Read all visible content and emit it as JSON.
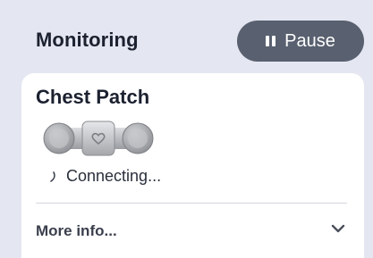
{
  "monitoring": {
    "title": "Monitoring",
    "pause_label": "Pause"
  },
  "device": {
    "name": "Chest Patch",
    "status": "Connecting...",
    "more_info_label": "More info..."
  },
  "colors": {
    "background": "#e4e6f1",
    "pause_button": "#59606f",
    "card": "#ffffff"
  },
  "icons": [
    "pause-icon",
    "chest-patch-device-icon",
    "heart-icon",
    "connecting-spinner-icon",
    "chevron-down-icon"
  ]
}
